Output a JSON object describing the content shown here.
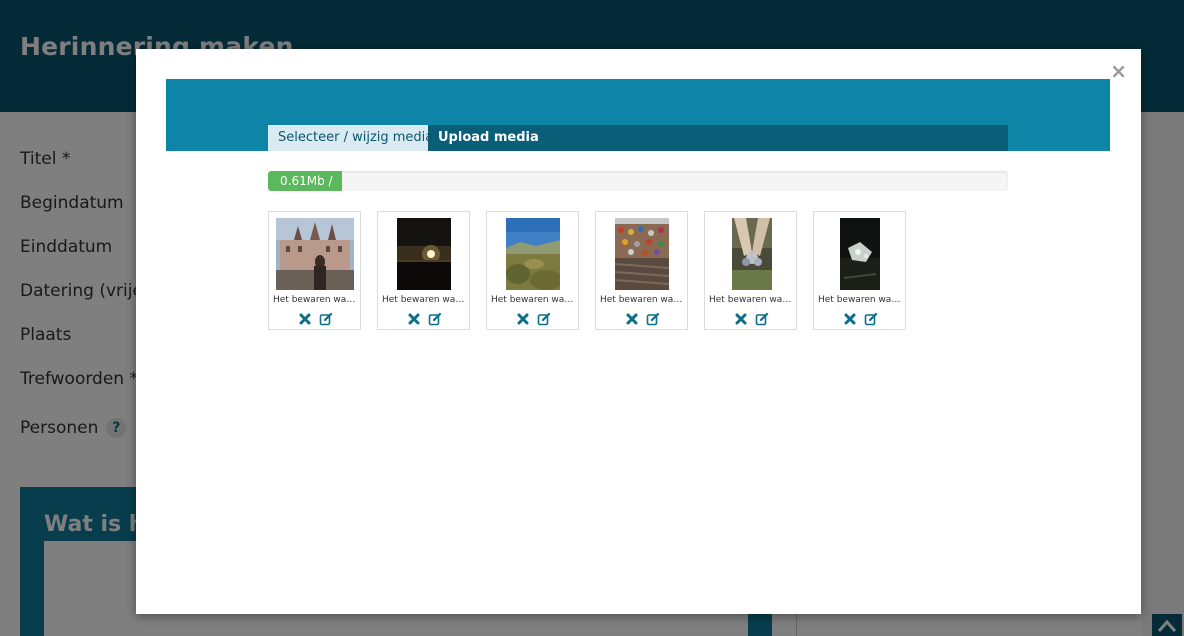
{
  "page": {
    "title": "Herinnering maken",
    "form_labels": [
      "Titel *",
      "Begindatum",
      "Einddatum",
      "Datering (vrije",
      "Plaats",
      "Trefwoorden *"
    ],
    "personen_label": "Personen",
    "help_symbol": "?",
    "box_title": "Wat is h"
  },
  "modal": {
    "close_symbol": "×",
    "tabs": [
      {
        "label": "Selecteer / wijzig media",
        "active": true
      },
      {
        "label": "Upload media",
        "active": false
      }
    ],
    "usage": {
      "label": "0.61Mb /",
      "fraction": 0.1
    }
  },
  "media": [
    {
      "caption": "Het bewaren waardevolle herinneringen",
      "image": "castle-photo"
    },
    {
      "caption": "Het bewaren waardevolle herinneringen",
      "image": "sunset-photo"
    },
    {
      "caption": "Het bewaren waardevolle herinneringen",
      "image": "landscape-photo"
    },
    {
      "caption": "Het bewaren waardevolle herinneringen",
      "image": "love-locks-photo"
    },
    {
      "caption": "Het bewaren waardevolle herinneringen",
      "image": "shoes-photo"
    },
    {
      "caption": "Het bewaren waardevolle herinneringen",
      "image": "night-photo"
    }
  ],
  "icons": {
    "delete": "remove-icon",
    "edit": "edit-icon",
    "scroll": "chevron-up-icon"
  },
  "colors": {
    "header": "#0b5770",
    "banner": "#0e85a7",
    "progress": "#5cb85c",
    "icon": "#0b6e8c"
  }
}
